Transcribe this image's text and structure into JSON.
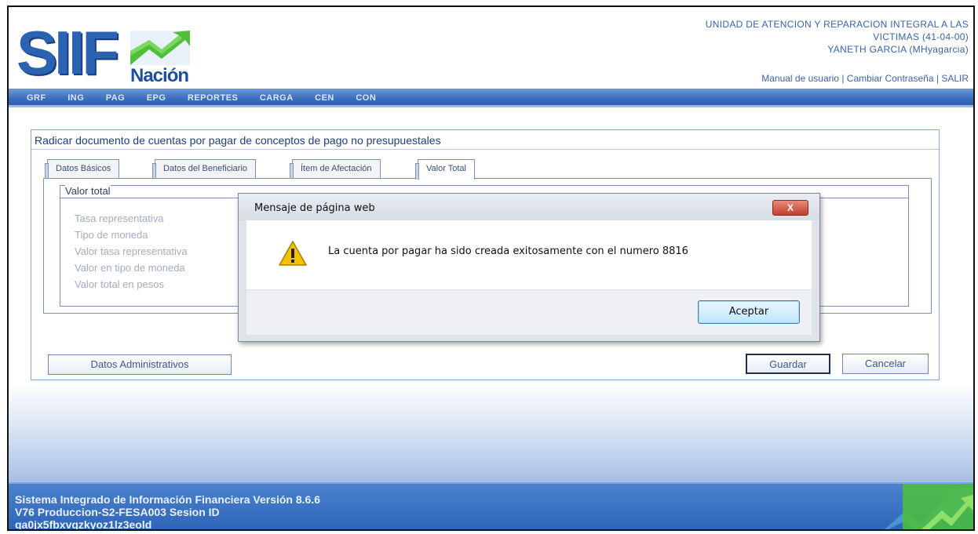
{
  "header": {
    "logo_text": "SIIF",
    "logo_sub": "Nación",
    "entity_line1": "UNIDAD DE ATENCION Y REPARACION INTEGRAL A LAS",
    "entity_line2": "VICTIMAS (41-04-00)",
    "user": "YANETH GARCIA (MHyagarcia)",
    "link_manual": "Manual de usuario",
    "separator": "|",
    "link_password": "Cambiar Contraseña",
    "link_exit": "SALIR"
  },
  "nav": [
    "GRF",
    "ING",
    "PAG",
    "EPG",
    "REPORTES",
    "CARGA",
    "CEN",
    "CON"
  ],
  "page": {
    "title": "Radicar documento de cuentas por pagar de conceptos de pago no presupuestales",
    "tabs": [
      "Datos Básicos",
      "Datos del Beneficiario",
      "Ítem de Afectación",
      "Valor Total"
    ],
    "active_tab": "Valor Total",
    "fieldset_legend": "Valor total",
    "fields": [
      "Tasa representativa",
      "Tipo de moneda",
      "Valor tasa representativa",
      "Valor en tipo de moneda",
      "Valor total en pesos"
    ],
    "btn_admin": "Datos Administrativos",
    "btn_save": "Guardar",
    "btn_cancel": "Cancelar"
  },
  "dialog": {
    "title": "Mensaje de página web",
    "message": "La cuenta por pagar ha sido creada exitosamente con el numero 8816",
    "ok": "Aceptar",
    "close": "X",
    "icon": "warning-icon"
  },
  "footer": {
    "line1": "Sistema Integrado de Información Financiera Versión 8.6.6",
    "line2": "V76 Produccion-S2-FESA003 Sesion ID",
    "line3": "qa0jx5fbxvqzkyoz1lz3eold"
  },
  "colors": {
    "accent": "#2b63b2",
    "nav": "#3c6ec0",
    "footer": "#2c63b5",
    "logo_green": "#4fbf3a"
  }
}
